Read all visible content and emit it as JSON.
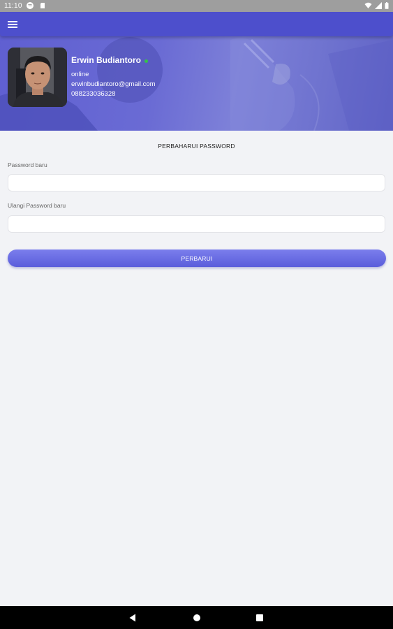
{
  "status_bar": {
    "time": "11:10",
    "icons": [
      "spotify-icon",
      "sd-card-icon",
      "wifi-icon",
      "signal-icon",
      "battery-icon"
    ]
  },
  "toolbar": {
    "menu_icon": "hamburger-menu-icon",
    "color": "#4d4fcc"
  },
  "profile": {
    "name": "Erwin Budiantoro",
    "status": "online",
    "email": "erwinbudiantoro@gmail.com",
    "phone": "088233036328",
    "status_color": "#34c24a"
  },
  "form": {
    "title": "PERBAHARUI PASSWORD",
    "new_password_label": "Password baru",
    "new_password_value": "",
    "repeat_password_label": "Ulangi Password baru",
    "repeat_password_value": "",
    "submit_label": "PERBARUI"
  },
  "nav_bar": {
    "icons": [
      "back-icon",
      "home-icon",
      "recents-icon"
    ]
  },
  "colors": {
    "accent": "#5c5fdc",
    "background": "#f2f3f6"
  }
}
